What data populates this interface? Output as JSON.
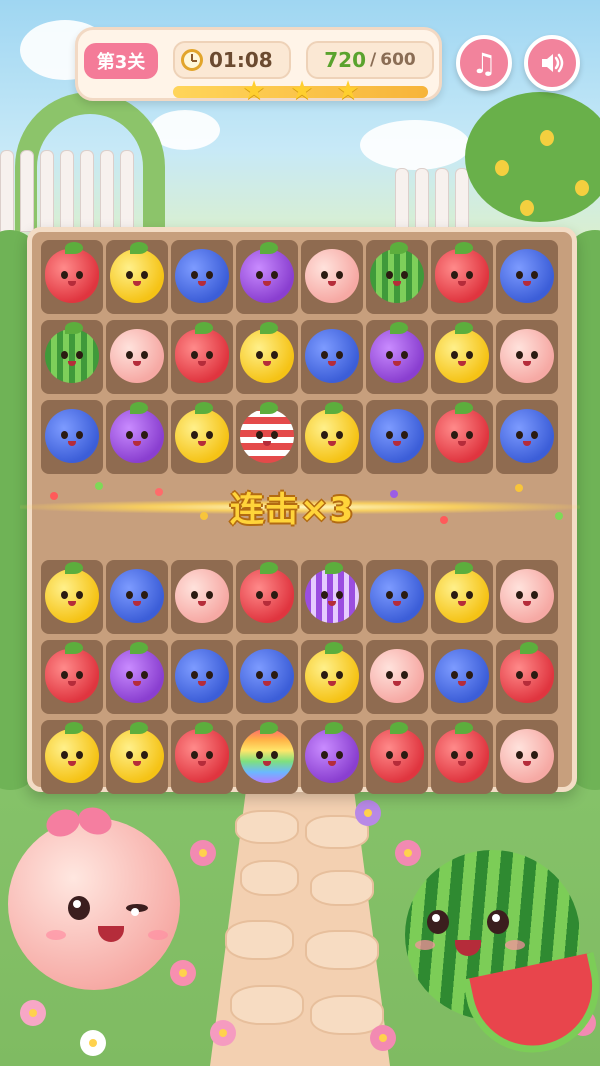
{
  "hud": {
    "level_label": "第3关",
    "timer": "01:08",
    "score": "720",
    "score_separator": "/",
    "score_target": "600",
    "stars_earned": 3,
    "progress_fraction": 1.0
  },
  "controls": {
    "music_icon": "music-note-icon",
    "sound_icon": "speaker-icon"
  },
  "board": {
    "rows": [
      [
        "strawberry",
        "lemon",
        "blueberry",
        "grape",
        "peach",
        "watermelon",
        "strawberry",
        "blueberry"
      ],
      [
        "watermelon",
        "peach",
        "strawberry",
        "lemon",
        "blueberry",
        "grape",
        "lemon",
        "peach"
      ],
      [
        "blueberry",
        "grape",
        "lemon",
        "striped-peach",
        "lemon",
        "blueberry",
        "strawberry",
        "blueberry"
      ],
      [
        "combo",
        "combo",
        "combo",
        "combo",
        "combo",
        "combo",
        "combo",
        "combo"
      ],
      [
        "lemon",
        "blueberry",
        "peach",
        "strawberry",
        "striped-grape",
        "blueberry",
        "lemon",
        "peach"
      ],
      [
        "strawberry",
        "grape",
        "blueberry",
        "blueberry",
        "lemon",
        "peach",
        "blueberry",
        "strawberry"
      ],
      [
        "lemon",
        "lemon",
        "strawberry",
        "rainbow",
        "grape",
        "strawberry",
        "strawberry",
        "peach"
      ]
    ]
  },
  "combo": {
    "text": "连击×3"
  },
  "colors": {
    "accent_pink": "#f47b98",
    "score_green": "#5aa32e",
    "star_gold": "#ffcf2e",
    "combo_gold": "#ffd43a"
  }
}
